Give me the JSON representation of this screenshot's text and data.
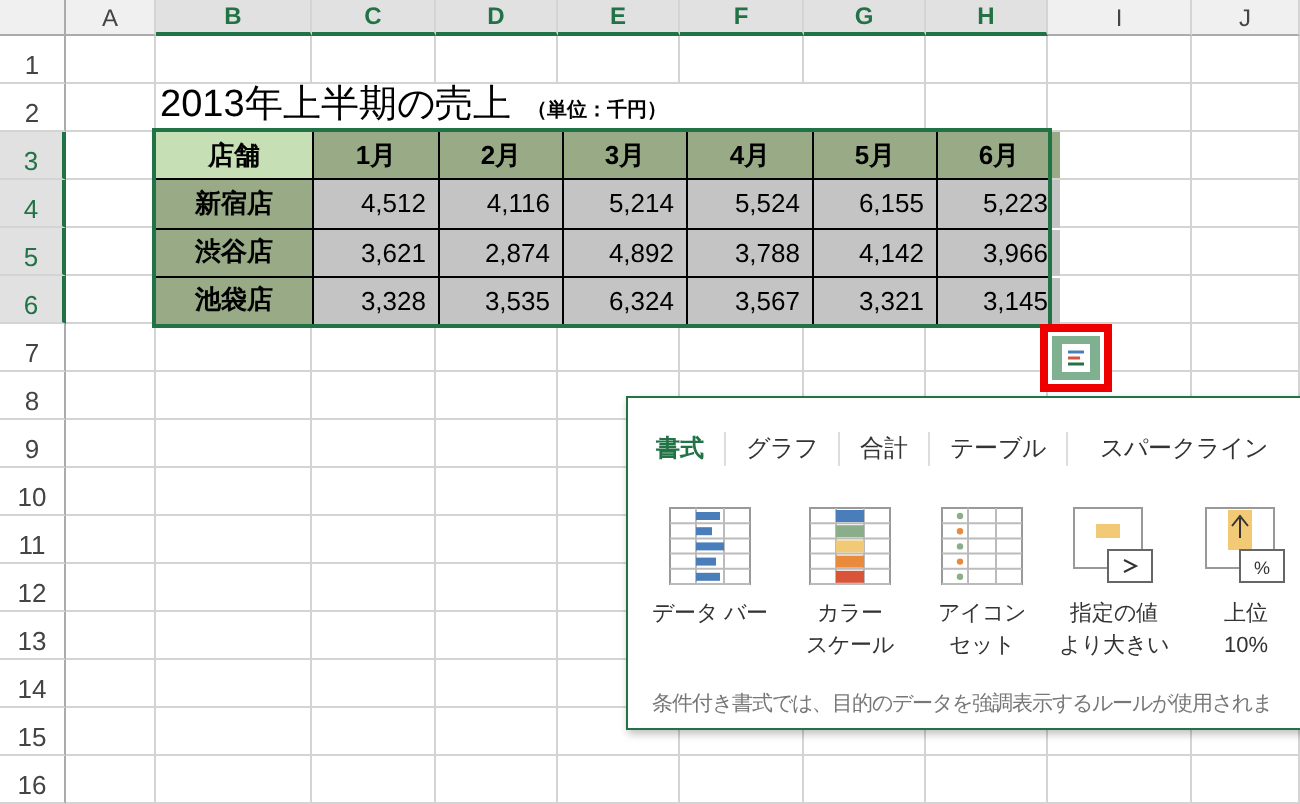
{
  "column_headers": [
    {
      "label": "A",
      "selected": false
    },
    {
      "label": "B",
      "selected": true
    },
    {
      "label": "C",
      "selected": true
    },
    {
      "label": "D",
      "selected": true
    },
    {
      "label": "E",
      "selected": true
    },
    {
      "label": "F",
      "selected": true
    },
    {
      "label": "G",
      "selected": true
    },
    {
      "label": "H",
      "selected": true
    },
    {
      "label": "I",
      "selected": false
    },
    {
      "label": "J",
      "selected": false
    }
  ],
  "row_headers": [
    {
      "label": "1",
      "selected": false
    },
    {
      "label": "2",
      "selected": false
    },
    {
      "label": "3",
      "selected": true
    },
    {
      "label": "4",
      "selected": true
    },
    {
      "label": "5",
      "selected": true
    },
    {
      "label": "6",
      "selected": true
    },
    {
      "label": "7",
      "selected": false
    },
    {
      "label": "8",
      "selected": false
    },
    {
      "label": "9",
      "selected": false
    },
    {
      "label": "10",
      "selected": false
    },
    {
      "label": "11",
      "selected": false
    },
    {
      "label": "12",
      "selected": false
    },
    {
      "label": "13",
      "selected": false
    },
    {
      "label": "14",
      "selected": false
    },
    {
      "label": "15",
      "selected": false
    },
    {
      "label": "16",
      "selected": false
    }
  ],
  "title": "2013年上半期の売上",
  "unit": "（単位：千円）",
  "table": {
    "columns": [
      "店舗",
      "1月",
      "2月",
      "3月",
      "4月",
      "5月",
      "6月"
    ],
    "rows": [
      [
        "新宿店",
        "4,512",
        "4,116",
        "5,214",
        "5,524",
        "6,155",
        "5,223"
      ],
      [
        "渋谷店",
        "3,621",
        "2,874",
        "4,892",
        "3,788",
        "4,142",
        "3,966"
      ],
      [
        "池袋店",
        "3,328",
        "3,535",
        "6,324",
        "3,567",
        "3,321",
        "3,145"
      ]
    ]
  },
  "quick_analysis": {
    "tabs": [
      {
        "label": "書式",
        "selected": true
      },
      {
        "label": "グラフ",
        "selected": false
      },
      {
        "label": "合計",
        "selected": false
      },
      {
        "label": "テーブル",
        "selected": false
      },
      {
        "label": "スパークライン",
        "selected": false
      }
    ],
    "items": [
      {
        "kind": "data_bar",
        "label_lines": [
          "データ バー"
        ]
      },
      {
        "kind": "color_scale",
        "label_lines": [
          "カラー",
          "スケール"
        ]
      },
      {
        "kind": "icon_set",
        "label_lines": [
          "アイコン",
          "セット"
        ]
      },
      {
        "kind": "greater_than",
        "label_lines": [
          "指定の値",
          "より大きい"
        ]
      },
      {
        "kind": "top_10",
        "label_lines": [
          "上位",
          "10%"
        ],
        "icon_text": "%"
      }
    ],
    "description": "条件付き書式では、目的のデータを強調表示するルールが使用されま"
  }
}
